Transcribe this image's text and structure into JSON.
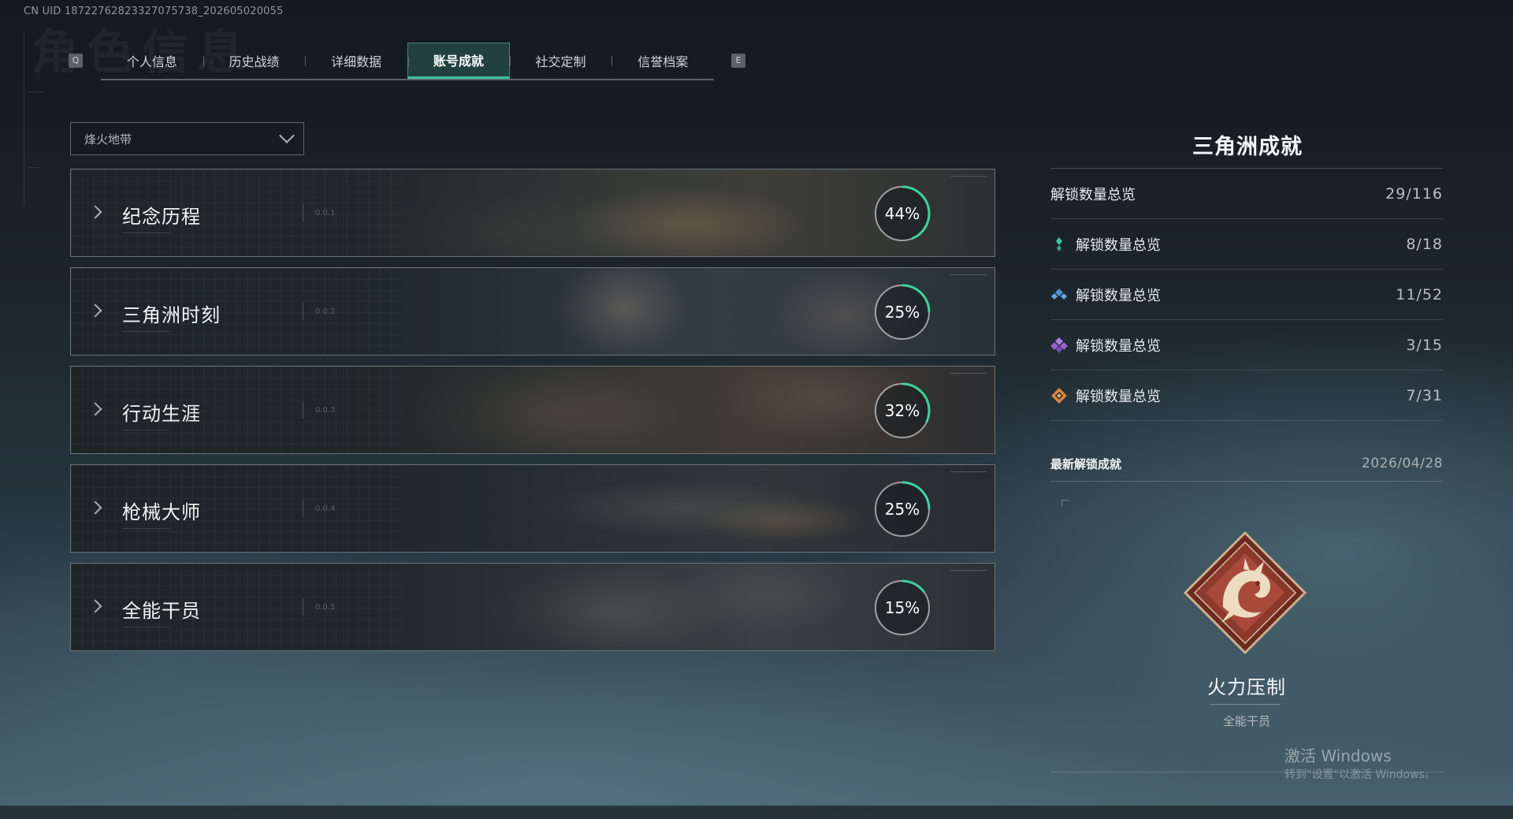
{
  "uid_text": "CN UID 18722762823327075738_202605020055",
  "header_bg_title": "角色信息",
  "tabs": {
    "left_key": "Q",
    "right_key": "E",
    "items": [
      {
        "label": "个人信息",
        "active": false
      },
      {
        "label": "历史战绩",
        "active": false
      },
      {
        "label": "详细数据",
        "active": false
      },
      {
        "label": "账号成就",
        "active": true
      },
      {
        "label": "社交定制",
        "active": false
      },
      {
        "label": "信誉档案",
        "active": false
      }
    ]
  },
  "mode_select": {
    "value": "烽火地带"
  },
  "categories": [
    {
      "label": "纪念历程",
      "index": "0.0.1",
      "progress_text": "44%",
      "progress": 0.44
    },
    {
      "label": "三角洲时刻",
      "index": "0.0.2",
      "progress_text": "25%",
      "progress": 0.25
    },
    {
      "label": "行动生涯",
      "index": "0.0.3",
      "progress_text": "32%",
      "progress": 0.32
    },
    {
      "label": "枪械大师",
      "index": "0.0.4",
      "progress_text": "25%",
      "progress": 0.25
    },
    {
      "label": "全能干员",
      "index": "0.0.5",
      "progress_text": "15%",
      "progress": 0.15
    }
  ],
  "summary": {
    "title": "三角洲成就",
    "total": {
      "label": "解锁数量总览",
      "value": "29/116"
    },
    "tiers": [
      {
        "label": "解锁数量总览",
        "value": "8/18",
        "icon": "green-gem-icon",
        "color": "#36c9a0"
      },
      {
        "label": "解锁数量总览",
        "value": "11/52",
        "icon": "blue-gem-icon",
        "color": "#4f8fd6"
      },
      {
        "label": "解锁数量总览",
        "value": "3/15",
        "icon": "purple-gem-icon",
        "color": "#9a5fd2"
      },
      {
        "label": "解锁数量总览",
        "value": "7/31",
        "icon": "orange-gem-icon",
        "color": "#d98440"
      }
    ]
  },
  "latest": {
    "title": "最新解锁成就",
    "date": "2026/04/28",
    "achievement_name": "火力压制",
    "achievement_category": "全能干员",
    "badge_icon": "dragon-badge-icon"
  },
  "watermark": {
    "line1": "激活 Windows",
    "line2": "转到\"设置\"以激活 Windows。"
  }
}
